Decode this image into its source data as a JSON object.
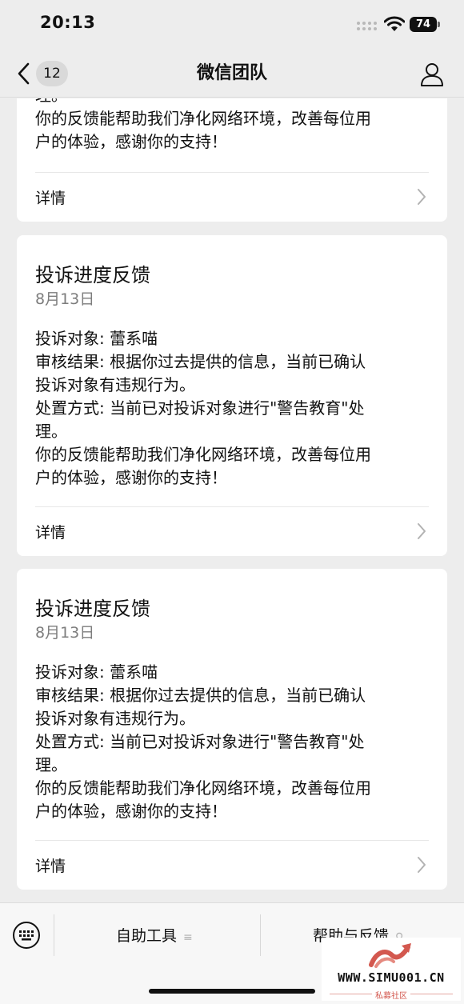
{
  "status_bar": {
    "time": "20:13",
    "battery": "74"
  },
  "nav": {
    "unread_count": "12",
    "title": "微信团队"
  },
  "cards": [
    {
      "body": [
        "理。",
        "你的反馈能帮助我们净化网络环境，改善每位用",
        "户的体验，感谢你的支持！"
      ],
      "detail": "详情"
    },
    {
      "title": "投诉进度反馈",
      "date": "8月13日",
      "body": [
        "投诉对象: 蕾系喵",
        "审核结果: 根据你过去提供的信息，当前已确认",
        "投诉对象有违规行为。",
        "处置方式: 当前已对投诉对象进行\"警告教育\"处",
        "理。",
        "你的反馈能帮助我们净化网络环境，改善每位用",
        "户的体验，感谢你的支持！"
      ],
      "detail": "详情"
    },
    {
      "title": "投诉进度反馈",
      "date": "8月13日",
      "body": [
        "投诉对象: 蕾系喵",
        "审核结果: 根据你过去提供的信息，当前已确认",
        "投诉对象有违规行为。",
        "处置方式: 当前已对投诉对象进行\"警告教育\"处",
        "理。",
        "你的反馈能帮助我们净化网络环境，改善每位用",
        "户的体验，感谢你的支持！"
      ],
      "detail": "详情"
    }
  ],
  "bottom_menu": {
    "keyboard_icon": "keyboard-icon",
    "items": [
      {
        "label": "自助工具",
        "icon": "menu-list-icon"
      },
      {
        "label": "帮助与反馈",
        "icon": "link-icon"
      }
    ]
  },
  "watermark": {
    "url": "WWW.SIMU001.CN",
    "subtitle": "私募社区"
  },
  "colors": {
    "background": "#ededed",
    "card": "#ffffff",
    "secondary_text": "#7d7d7d",
    "watermark_accent": "#d3584f"
  }
}
